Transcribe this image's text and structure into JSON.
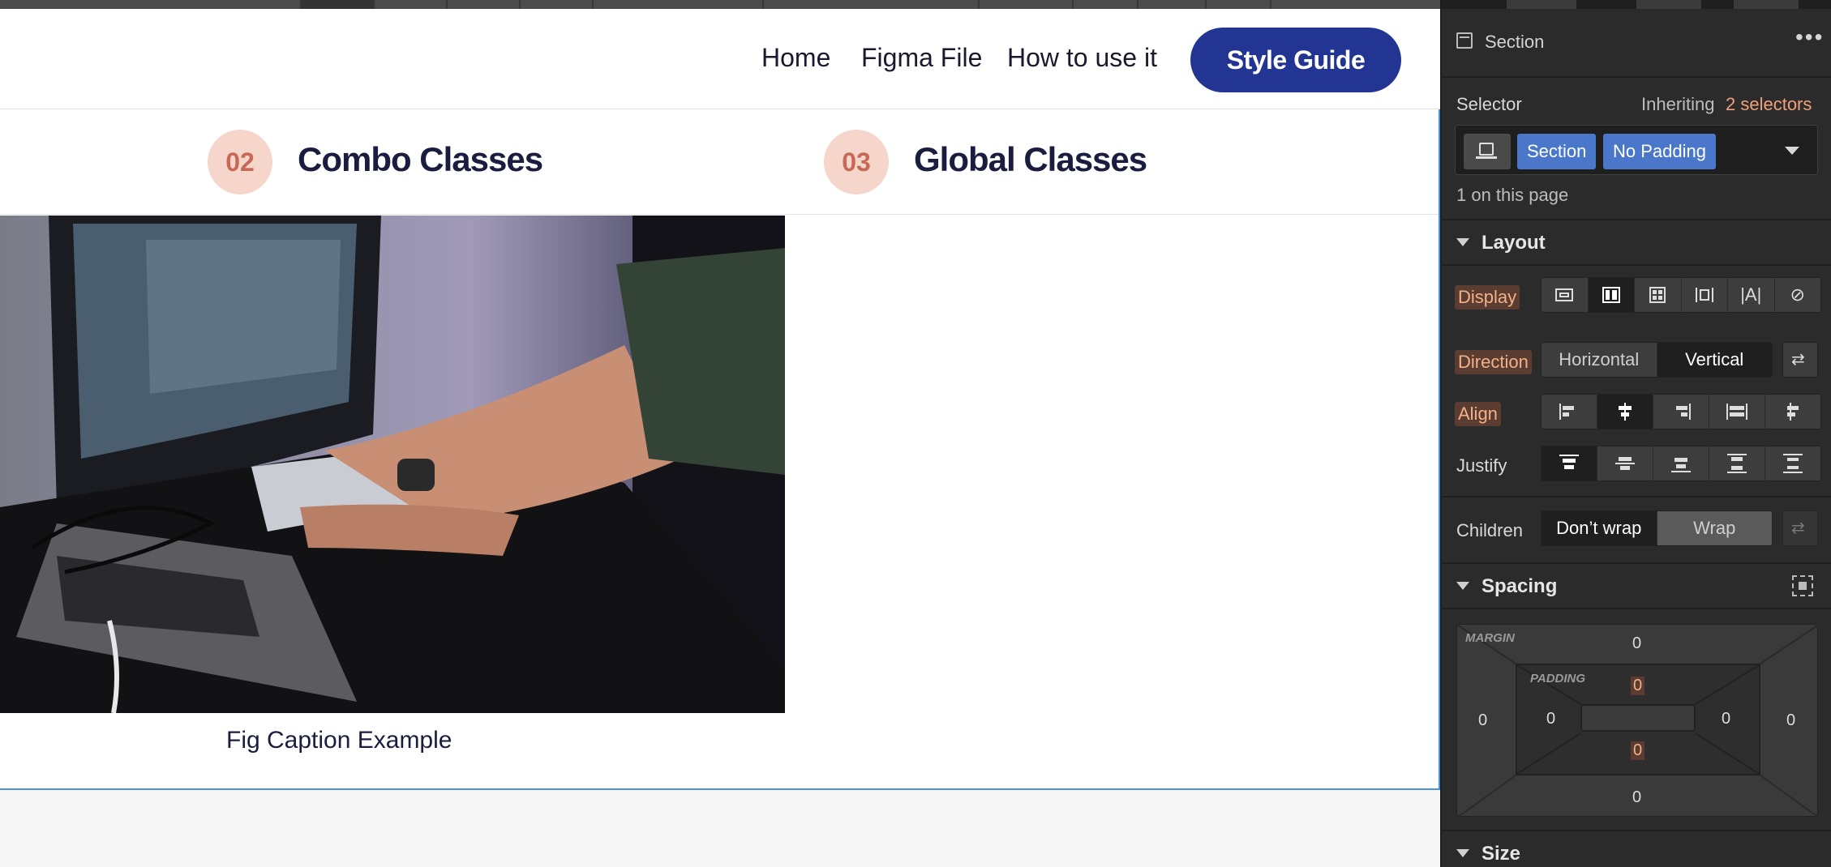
{
  "nav": {
    "links": [
      "Home",
      "Figma File",
      "How to use it"
    ],
    "cta": "Style Guide",
    "cta_color": "#233592"
  },
  "tabs": [
    {
      "num": "02",
      "title": "Combo Classes"
    },
    {
      "num": "03",
      "title": "Global Classes"
    }
  ],
  "figure": {
    "caption": "Fig Caption Example"
  },
  "panel": {
    "element_type": "Section",
    "selector_label": "Selector",
    "inheriting_prefix": "Inheriting",
    "inheriting_link": "2 selectors",
    "chips": [
      "Section",
      "No Padding"
    ],
    "on_page": "1 on this page",
    "layout": {
      "title": "Layout",
      "display_label": "Display",
      "direction_label": "Direction",
      "direction_options": [
        "Horizontal",
        "Vertical"
      ],
      "direction_selected": "Vertical",
      "align_label": "Align",
      "justify_label": "Justify",
      "children_label": "Children",
      "children_options": [
        "Don’t wrap",
        "Wrap"
      ],
      "children_selected": "Don’t wrap"
    },
    "spacing": {
      "title": "Spacing",
      "margin_label": "MARGIN",
      "padding_label": "PADDING",
      "margin": {
        "top": "0",
        "right": "0",
        "bottom": "0",
        "left": "0"
      },
      "padding": {
        "top": "0",
        "right": "0",
        "bottom": "0",
        "left": "0"
      }
    },
    "size": {
      "title": "Size"
    }
  }
}
